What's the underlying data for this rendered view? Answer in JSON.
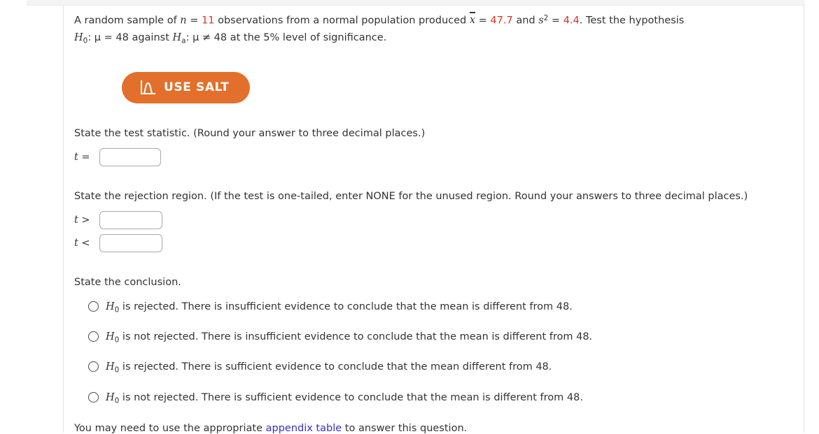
{
  "problem": {
    "line1_a": "A random sample of ",
    "n_symbol": "n",
    "n_eq": " = ",
    "n_value": "11",
    "line1_b": " observations from a normal population produced ",
    "xbar_symbol": "x",
    "xbar_eq": " = ",
    "xbar_value": "47.7",
    "line1_c": " and ",
    "s_symbol": "s",
    "s_exponent": "2",
    "s_eq": " = ",
    "s_value": "4.4",
    "line1_d": ". Test the hypothesis",
    "h0_symbol": "H",
    "h0_sub": "0",
    "h0_statement": ": μ = 48 against ",
    "ha_symbol": "H",
    "ha_sub": "a",
    "ha_statement": ": μ ≠ 48 at the 5% level of significance."
  },
  "salt": {
    "label": "USE SALT",
    "icon": "distribution-curve-icon",
    "color": "#e2702c"
  },
  "test_statistic": {
    "label": "State the test statistic. (Round your answer to three decimal places.)",
    "prefix_var": "t",
    "prefix_op": " = ",
    "value": "",
    "placeholder": ""
  },
  "rejection_region": {
    "label": "State the rejection region. (If the test is one-tailed, enter NONE for the unused region. Round your answers to three decimal places.)",
    "rows": [
      {
        "prefix_var": "t",
        "prefix_op": " > ",
        "value": "",
        "placeholder": ""
      },
      {
        "prefix_var": "t",
        "prefix_op": " < ",
        "value": "",
        "placeholder": ""
      }
    ]
  },
  "conclusion": {
    "label": "State the conclusion.",
    "options": [
      {
        "h_symbol": "H",
        "h_sub": "0",
        "text": " is rejected. There is insufficient evidence to conclude that the mean is different from 48.",
        "selected": false
      },
      {
        "h_symbol": "H",
        "h_sub": "0",
        "text": " is not rejected. There is insufficient evidence to conclude that the mean is different from 48.",
        "selected": false
      },
      {
        "h_symbol": "H",
        "h_sub": "0",
        "text": " is rejected. There is sufficient evidence to conclude that the mean different from 48.",
        "selected": false
      },
      {
        "h_symbol": "H",
        "h_sub": "0",
        "text": " is not rejected. There is sufficient evidence to conclude that the mean is different from 48.",
        "selected": false
      }
    ]
  },
  "footer": {
    "before_link": "You may need to use the appropriate ",
    "link_text": "appendix table",
    "after_link": " to answer this question."
  }
}
